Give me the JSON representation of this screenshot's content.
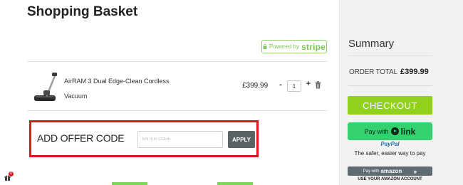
{
  "header": {
    "title": "Shopping Basket"
  },
  "stripe": {
    "prefix": "Powered by",
    "brand": "stripe"
  },
  "basket": {
    "items": [
      {
        "name": "AirRAM 3 Dual Edge-Clean Cordless Vacuum",
        "price": "£399.99",
        "quantity": "1"
      }
    ],
    "qty_minus": "-",
    "qty_plus": "+"
  },
  "offer": {
    "label": "ADD OFFER CODE",
    "placeholder": "ENTER CODE",
    "value": "",
    "apply_label": "APPLY"
  },
  "summary": {
    "title": "Summary",
    "order_total_label": "ORDER TOTAL",
    "order_total_value": "£399.99",
    "checkout_label": "CHECKOUT",
    "link_prefix": "Pay with",
    "link_brand": "link",
    "paypal_logo": "PayPal",
    "paypal_tagline": "The safer, easier way to pay",
    "amazon_prefix": "Pay with",
    "amazon_brand": "amazon",
    "amazon_chevron": "»",
    "amazon_caption": "USE YOUR AMAZON ACCOUNT"
  },
  "gift": {
    "badge_count": "0"
  },
  "colors": {
    "accent_green": "#8fd11c",
    "link_green": "#33d26e",
    "highlight_red": "#e0171f",
    "apply_gray": "#5b6366",
    "paypal_blue": "#1f6fb5"
  },
  "icons": [
    "lock-icon",
    "trash-icon",
    "gift-icon",
    "link-logo-icon",
    "product-image"
  ]
}
